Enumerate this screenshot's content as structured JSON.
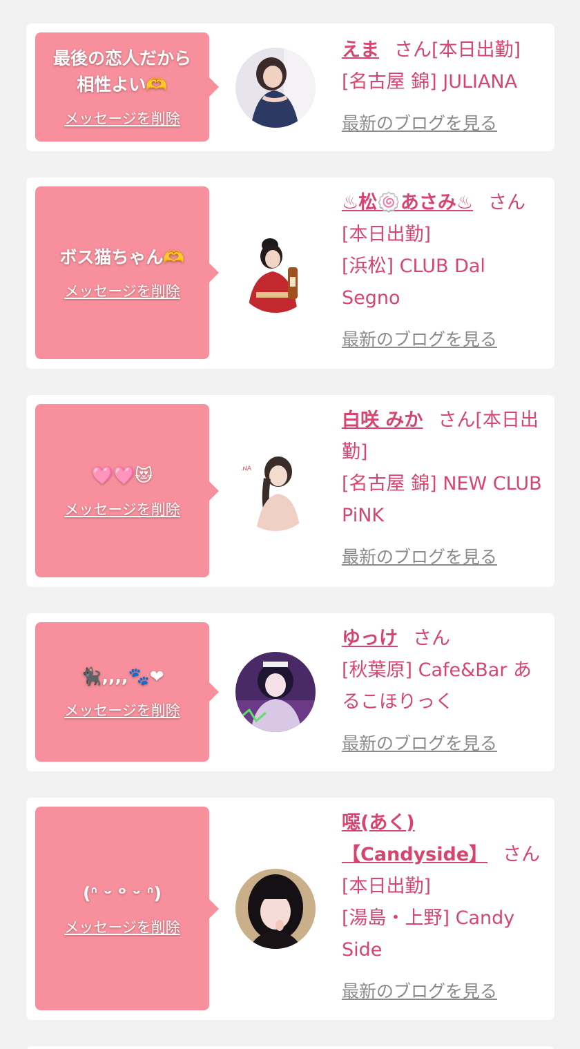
{
  "delete_label": "メッセージを削除",
  "blog_label": "最新のブログを見る",
  "colors": {
    "bubble": "#f7909c",
    "accent": "#d6456f",
    "muted": "#8a8a8a",
    "background": "#f2f2f2"
  },
  "items": [
    {
      "message": "最後の恋人だから相性よい🫶",
      "name": "えま",
      "suffix": "さん[本日出勤]",
      "shop": "[名古屋 錦] JULIANA",
      "avatar": "cast-photo"
    },
    {
      "message": "ボス猫ちゃん🫶",
      "name": "♨松🍥あさみ♨",
      "suffix": "さん[本日出勤]",
      "shop": "[浜松] CLUB Dal Segno",
      "avatar": "cast-photo"
    },
    {
      "message": "🩷🩷😻",
      "name": "白咲 みか",
      "suffix": "さん[本日出勤]",
      "shop": "[名古屋 錦] NEW CLUB PiNK",
      "avatar": "cast-photo"
    },
    {
      "message": "🐈‍⬛,,,,🐾❤",
      "name": "ゆっけ",
      "suffix": "さん",
      "shop": "[秋葉原] Cafe&Bar あるこほりっく",
      "avatar": "cast-photo"
    },
    {
      "message": "(ᐢ ᵕ ᵒ ᵕ ᐢ)",
      "name": "噁(あく)【Candyside】",
      "suffix": "さん[本日出勤]",
      "shop": "[湯島・上野] Candy Side",
      "avatar": "cast-photo"
    }
  ]
}
